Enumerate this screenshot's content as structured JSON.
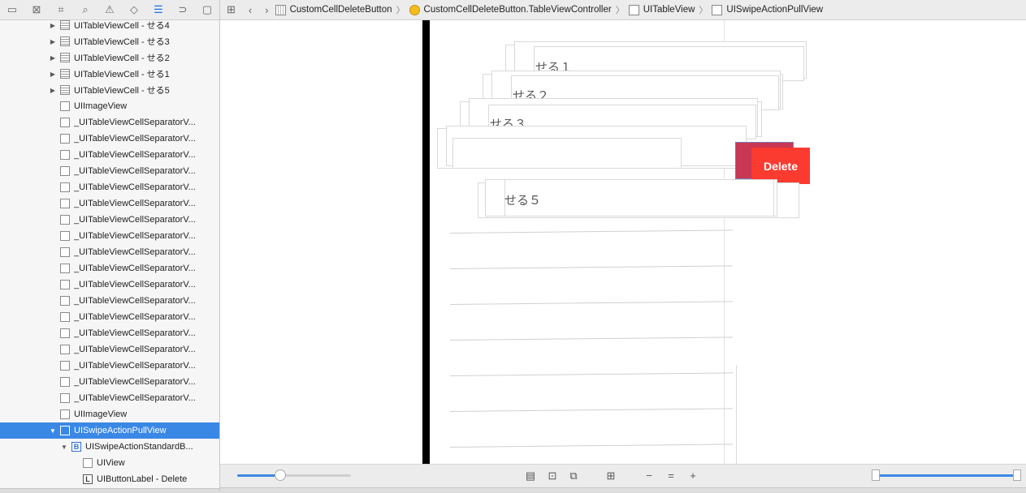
{
  "navigator": {
    "toolbar_icons": [
      "folder-icon",
      "source-control-icon",
      "hierarchy-icon",
      "search-icon",
      "warning-icon",
      "test-icon",
      "debug-icon",
      "breakpoint-icon",
      "report-icon"
    ],
    "rows": [
      {
        "label": "UITableViewCell - せる4",
        "icon": "cell",
        "disclosure": "▶",
        "indent": 1,
        "selected": false
      },
      {
        "label": "UITableViewCell - せる3",
        "icon": "cell",
        "disclosure": "▶",
        "indent": 1,
        "selected": false
      },
      {
        "label": "UITableViewCell - せる2",
        "icon": "cell",
        "disclosure": "▶",
        "indent": 1,
        "selected": false
      },
      {
        "label": "UITableViewCell - せる1",
        "icon": "cell",
        "disclosure": "▶",
        "indent": 1,
        "selected": false
      },
      {
        "label": "UITableViewCell - せる5",
        "icon": "cell",
        "disclosure": "▶",
        "indent": 1,
        "selected": false
      },
      {
        "label": "UIImageView",
        "icon": "img",
        "disclosure": "",
        "indent": 1,
        "selected": false
      },
      {
        "label": "_UITableViewCellSeparatorV...",
        "icon": "view",
        "disclosure": "",
        "indent": 1,
        "selected": false
      },
      {
        "label": "_UITableViewCellSeparatorV...",
        "icon": "view",
        "disclosure": "",
        "indent": 1,
        "selected": false
      },
      {
        "label": "_UITableViewCellSeparatorV...",
        "icon": "view",
        "disclosure": "",
        "indent": 1,
        "selected": false
      },
      {
        "label": "_UITableViewCellSeparatorV...",
        "icon": "view",
        "disclosure": "",
        "indent": 1,
        "selected": false
      },
      {
        "label": "_UITableViewCellSeparatorV...",
        "icon": "view",
        "disclosure": "",
        "indent": 1,
        "selected": false
      },
      {
        "label": "_UITableViewCellSeparatorV...",
        "icon": "view",
        "disclosure": "",
        "indent": 1,
        "selected": false
      },
      {
        "label": "_UITableViewCellSeparatorV...",
        "icon": "view",
        "disclosure": "",
        "indent": 1,
        "selected": false
      },
      {
        "label": "_UITableViewCellSeparatorV...",
        "icon": "view",
        "disclosure": "",
        "indent": 1,
        "selected": false
      },
      {
        "label": "_UITableViewCellSeparatorV...",
        "icon": "view",
        "disclosure": "",
        "indent": 1,
        "selected": false
      },
      {
        "label": "_UITableViewCellSeparatorV...",
        "icon": "view",
        "disclosure": "",
        "indent": 1,
        "selected": false
      },
      {
        "label": "_UITableViewCellSeparatorV...",
        "icon": "view",
        "disclosure": "",
        "indent": 1,
        "selected": false
      },
      {
        "label": "_UITableViewCellSeparatorV...",
        "icon": "view",
        "disclosure": "",
        "indent": 1,
        "selected": false
      },
      {
        "label": "_UITableViewCellSeparatorV...",
        "icon": "view",
        "disclosure": "",
        "indent": 1,
        "selected": false
      },
      {
        "label": "_UITableViewCellSeparatorV...",
        "icon": "view",
        "disclosure": "",
        "indent": 1,
        "selected": false
      },
      {
        "label": "_UITableViewCellSeparatorV...",
        "icon": "view",
        "disclosure": "",
        "indent": 1,
        "selected": false
      },
      {
        "label": "_UITableViewCellSeparatorV...",
        "icon": "view",
        "disclosure": "",
        "indent": 1,
        "selected": false
      },
      {
        "label": "_UITableViewCellSeparatorV...",
        "icon": "view",
        "disclosure": "",
        "indent": 1,
        "selected": false
      },
      {
        "label": "_UITableViewCellSeparatorV...",
        "icon": "view",
        "disclosure": "",
        "indent": 1,
        "selected": false
      },
      {
        "label": "UIImageView",
        "icon": "img",
        "disclosure": "",
        "indent": 1,
        "selected": false
      },
      {
        "label": "UISwipeActionPullView",
        "icon": "view",
        "disclosure": "▼",
        "indent": 1,
        "selected": true
      },
      {
        "label": "UISwipeActionStandardB...",
        "icon": "btn",
        "disclosure": "▼",
        "indent": 2,
        "selected": false
      },
      {
        "label": "UIView",
        "icon": "view",
        "disclosure": "",
        "indent": 3,
        "selected": false
      },
      {
        "label": "UIButtonLabel - Delete",
        "icon": "label",
        "disclosure": "",
        "indent": 3,
        "selected": false
      }
    ]
  },
  "breadcrumbs": {
    "items": [
      {
        "label": "CustomCellDeleteButton",
        "icon": "proj"
      },
      {
        "label": "CustomCellDeleteButton.TableViewController",
        "icon": "ctrl"
      },
      {
        "label": "UITableView",
        "icon": "view"
      },
      {
        "label": "UISwipeActionPullView",
        "icon": "view"
      }
    ],
    "separator": "〉"
  },
  "canvas": {
    "cells": [
      "せる１",
      "せる２",
      "せる３",
      "せる５"
    ],
    "delete_label": "Delete",
    "delete_color": "#fb3b30"
  },
  "statusbar": {
    "zoom_fraction": 0.38,
    "range_fraction": 1.0,
    "icons": [
      "frames-icon",
      "clip-icon",
      "wireframe-icon",
      "grid-icon",
      "spacing-minus-icon",
      "spacing-equal-icon",
      "spacing-plus-icon"
    ]
  }
}
